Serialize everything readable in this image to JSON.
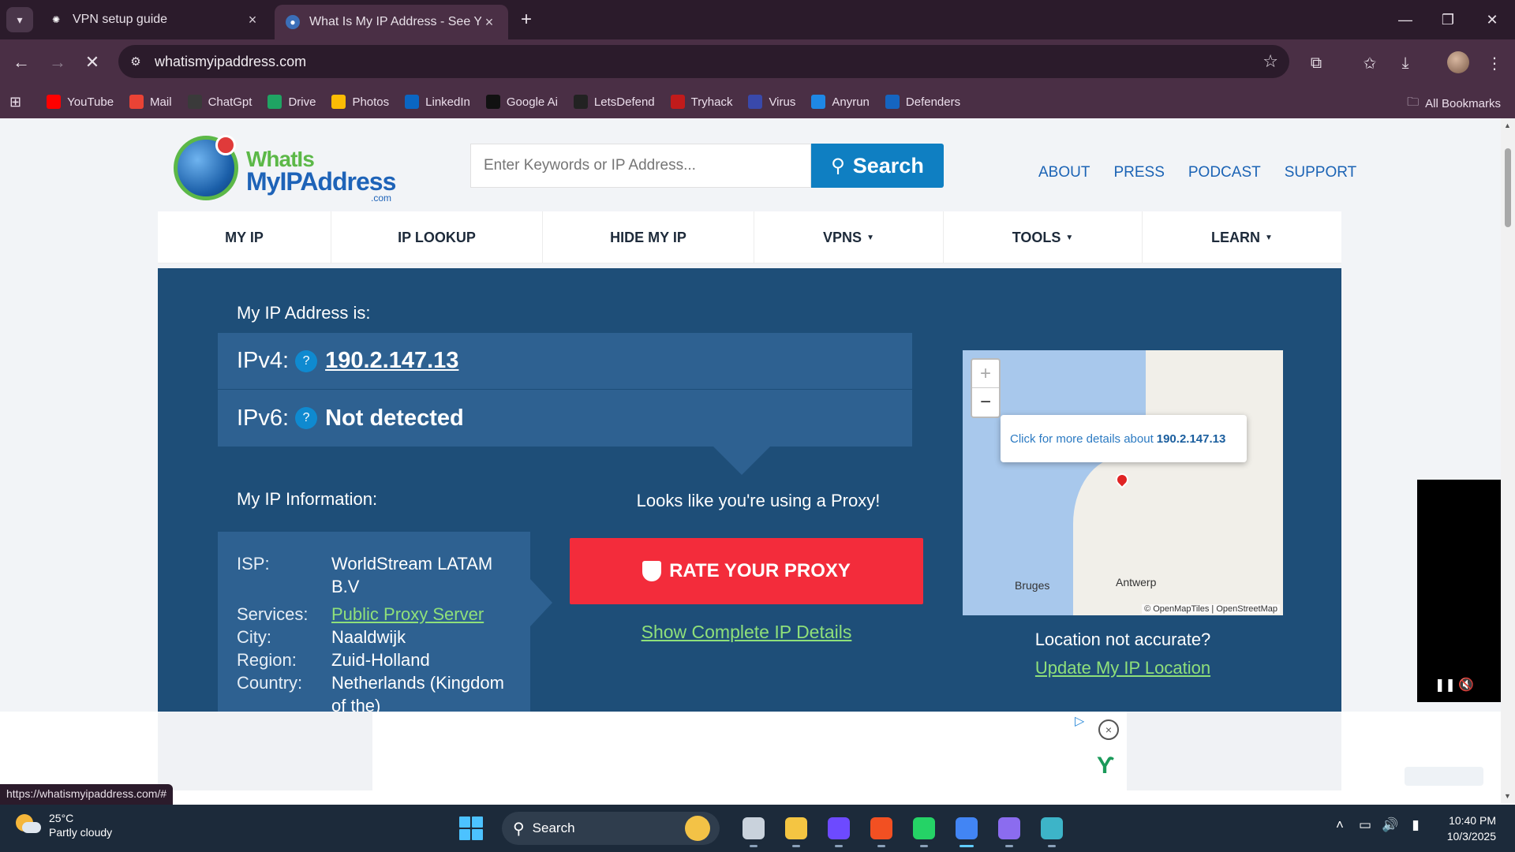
{
  "browser": {
    "tabs": [
      {
        "title": "VPN setup guide",
        "active": false
      },
      {
        "title": "What Is My IP Address - See Yo",
        "active": true
      }
    ],
    "url": "whatismyipaddress.com",
    "bookmarks": [
      {
        "label": "YouTube",
        "icon": "youtube-icon",
        "color": "#ff0000"
      },
      {
        "label": "Mail",
        "icon": "gmail-icon",
        "color": "#ea4335"
      },
      {
        "label": "ChatGpt",
        "icon": "chatgpt-icon",
        "color": "#3a3a3a"
      },
      {
        "label": "Drive",
        "icon": "drive-icon",
        "color": "#1fa463"
      },
      {
        "label": "Photos",
        "icon": "photos-icon",
        "color": "#fbbc04"
      },
      {
        "label": "LinkedIn",
        "icon": "linkedin-icon",
        "color": "#0a66c2"
      },
      {
        "label": "Google Ai",
        "icon": "google-ai-icon",
        "color": "#111111"
      },
      {
        "label": "LetsDefend",
        "icon": "letsdefend-icon",
        "color": "#222222"
      },
      {
        "label": "Tryhack",
        "icon": "tryhackme-icon",
        "color": "#c11b1b"
      },
      {
        "label": "Virus",
        "icon": "virustotal-icon",
        "color": "#3949ab"
      },
      {
        "label": "Anyrun",
        "icon": "anyrun-icon",
        "color": "#1e88e5"
      },
      {
        "label": "Defenders",
        "icon": "defenders-icon",
        "color": "#1565c0"
      }
    ],
    "all_bookmarks": "All Bookmarks",
    "status_url": "https://whatismyipaddress.com/#"
  },
  "site": {
    "logo": {
      "line1": "WhatIs",
      "line2": "MyIPAddress",
      "line3": ".com"
    },
    "search_placeholder": "Enter Keywords or IP Address...",
    "search_button": "Search",
    "top_links": [
      "ABOUT",
      "PRESS",
      "PODCAST",
      "SUPPORT"
    ],
    "nav": [
      {
        "label": "MY IP",
        "dropdown": false
      },
      {
        "label": "IP LOOKUP",
        "dropdown": false
      },
      {
        "label": "HIDE MY IP",
        "dropdown": false
      },
      {
        "label": "VPNS",
        "dropdown": true
      },
      {
        "label": "TOOLS",
        "dropdown": true
      },
      {
        "label": "LEARN",
        "dropdown": true
      }
    ]
  },
  "hero": {
    "ip_heading": "My IP Address is:",
    "ipv4_label": "IPv4:",
    "ipv4_value": "190.2.147.13",
    "ipv6_label": "IPv6:",
    "ipv6_value": "Not detected",
    "help_glyph": "?",
    "info_heading": "My IP Information:",
    "info": [
      {
        "key": "ISP:",
        "value": "WorldStream LATAM B.V",
        "link": false
      },
      {
        "key": "Services:",
        "value": "Public Proxy Server",
        "link": true
      },
      {
        "key": "City:",
        "value": "Naaldwijk",
        "link": false
      },
      {
        "key": "Region:",
        "value": "Zuid-Holland",
        "link": false
      },
      {
        "key": "Country:",
        "value": "Netherlands (Kingdom of the)",
        "link": false
      }
    ],
    "proxy_message": "Looks like you're using a Proxy!",
    "rate_button": "RATE YOUR PROXY",
    "complete_link": "Show Complete IP Details",
    "map_popup_text": "Click for more details about",
    "map_popup_ip": "190.2.147.13",
    "map_cities": [
      "Bruges",
      "Antwerp"
    ],
    "map_attribution": "© OpenMapTiles | OpenStreetMap",
    "location_question": "Location not accurate?",
    "update_link": "Update My IP Location"
  },
  "taskbar": {
    "weather_temp": "25°C",
    "weather_desc": "Partly cloudy",
    "search_label": "Search",
    "time": "10:40 PM",
    "date": "10/3/2025",
    "apps": [
      {
        "name": "task-view-icon",
        "color": "#c9d2dc",
        "active": false
      },
      {
        "name": "file-explorer-icon",
        "color": "#f4c542",
        "active": false
      },
      {
        "name": "proton-icon",
        "color": "#6d4aff",
        "active": false
      },
      {
        "name": "microsoft-store-icon",
        "color": "#f25022",
        "active": false
      },
      {
        "name": "whatsapp-icon",
        "color": "#25d366",
        "active": false
      },
      {
        "name": "chrome-icon",
        "color": "#4285f4",
        "active": true
      },
      {
        "name": "obsidian-icon",
        "color": "#8b6cef",
        "active": false
      },
      {
        "name": "vpn-app-icon",
        "color": "#3db4c8",
        "active": false
      }
    ]
  }
}
